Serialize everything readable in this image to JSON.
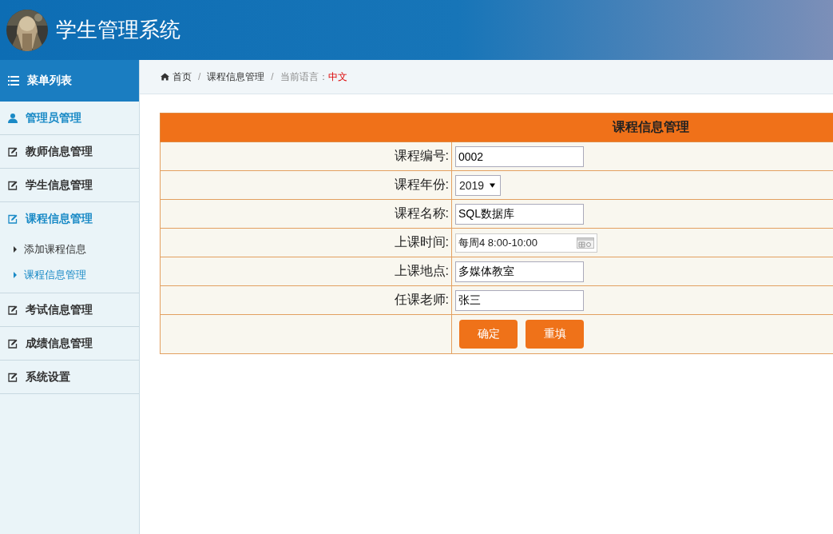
{
  "header": {
    "title": "学生管理系统"
  },
  "sidebar": {
    "title": "菜单列表",
    "items": [
      {
        "label": "管理员管理",
        "kind": "user",
        "selected": true
      },
      {
        "label": "教师信息管理",
        "kind": "edit",
        "selected": false
      },
      {
        "label": "学生信息管理",
        "kind": "edit",
        "selected": false
      },
      {
        "label": "课程信息管理",
        "kind": "edit",
        "selected": true,
        "children": [
          {
            "label": "添加课程信息",
            "selected": false
          },
          {
            "label": "课程信息管理",
            "selected": true
          }
        ]
      },
      {
        "label": "考试信息管理",
        "kind": "edit",
        "selected": false
      },
      {
        "label": "成绩信息管理",
        "kind": "edit",
        "selected": false
      },
      {
        "label": "系统设置",
        "kind": "edit",
        "selected": false
      }
    ]
  },
  "breadcrumb": {
    "items": [
      "首页",
      "课程信息管理"
    ],
    "separator": "/",
    "language_label": "当前语言：",
    "language": "中文"
  },
  "form": {
    "title": "课程信息管理",
    "fields": [
      {
        "kind": "text",
        "label": "课程编号:",
        "value": "0002"
      },
      {
        "kind": "select",
        "label": "课程年份:",
        "value": "2019"
      },
      {
        "kind": "text",
        "label": "课程名称:",
        "value": "SQL数据库"
      },
      {
        "kind": "date",
        "label": "上课时间:",
        "value": "每周4 8:00-10:00"
      },
      {
        "kind": "text",
        "label": "上课地点:",
        "value": "多媒体教室"
      },
      {
        "kind": "text",
        "label": "任课老师:",
        "value": "张三"
      }
    ],
    "buttons": [
      "确定",
      "重填"
    ]
  }
}
